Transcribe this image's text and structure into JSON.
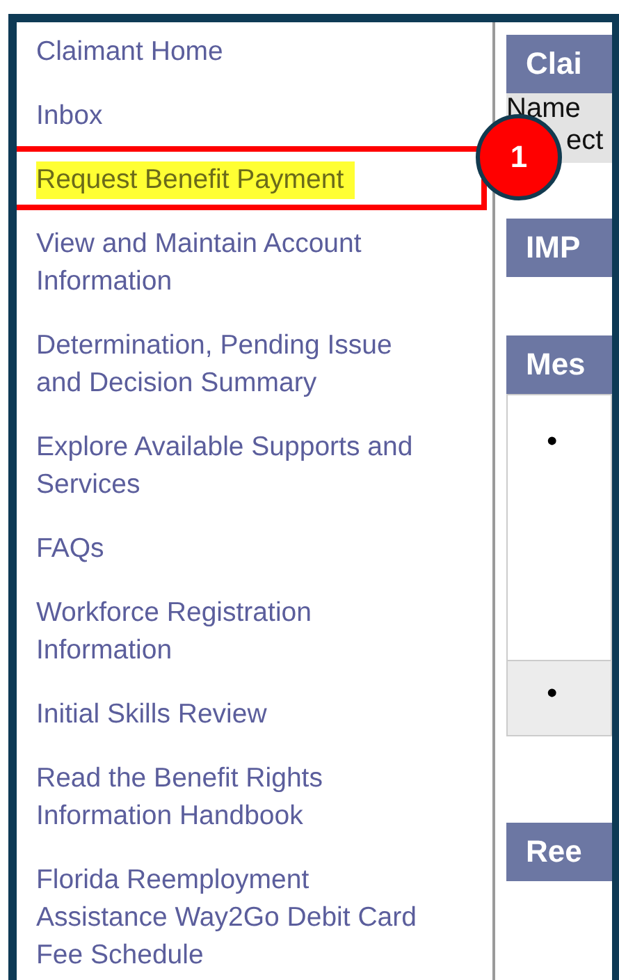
{
  "sidebar": {
    "items": [
      {
        "label": "Claimant Home",
        "highlighted": false
      },
      {
        "label": "Inbox",
        "highlighted": false
      },
      {
        "label": "Request Benefit Payment",
        "highlighted": true
      },
      {
        "label": "View and Maintain Account Information",
        "highlighted": false
      },
      {
        "label": "Determination, Pending Issue and Decision Summary",
        "highlighted": false
      },
      {
        "label": "Explore Available Supports and Services",
        "highlighted": false
      },
      {
        "label": "FAQs",
        "highlighted": false
      },
      {
        "label": "Workforce Registration Information",
        "highlighted": false
      },
      {
        "label": "Initial Skills Review",
        "highlighted": false
      },
      {
        "label": "Read the Benefit Rights Information Handbook",
        "highlighted": false
      },
      {
        "label": "Florida Reemployment Assistance Way2Go Debit Card Fee Schedule",
        "highlighted": false
      }
    ]
  },
  "callout": {
    "number": "1"
  },
  "panels": [
    {
      "kind": "info",
      "title": "Clai",
      "lines": [
        "Name",
        "ect"
      ]
    },
    {
      "kind": "plain",
      "title": "IMP"
    },
    {
      "kind": "messages",
      "title": "Mes",
      "bullets": [
        "•",
        "•"
      ]
    },
    {
      "kind": "plain",
      "title": "Ree"
    }
  ]
}
